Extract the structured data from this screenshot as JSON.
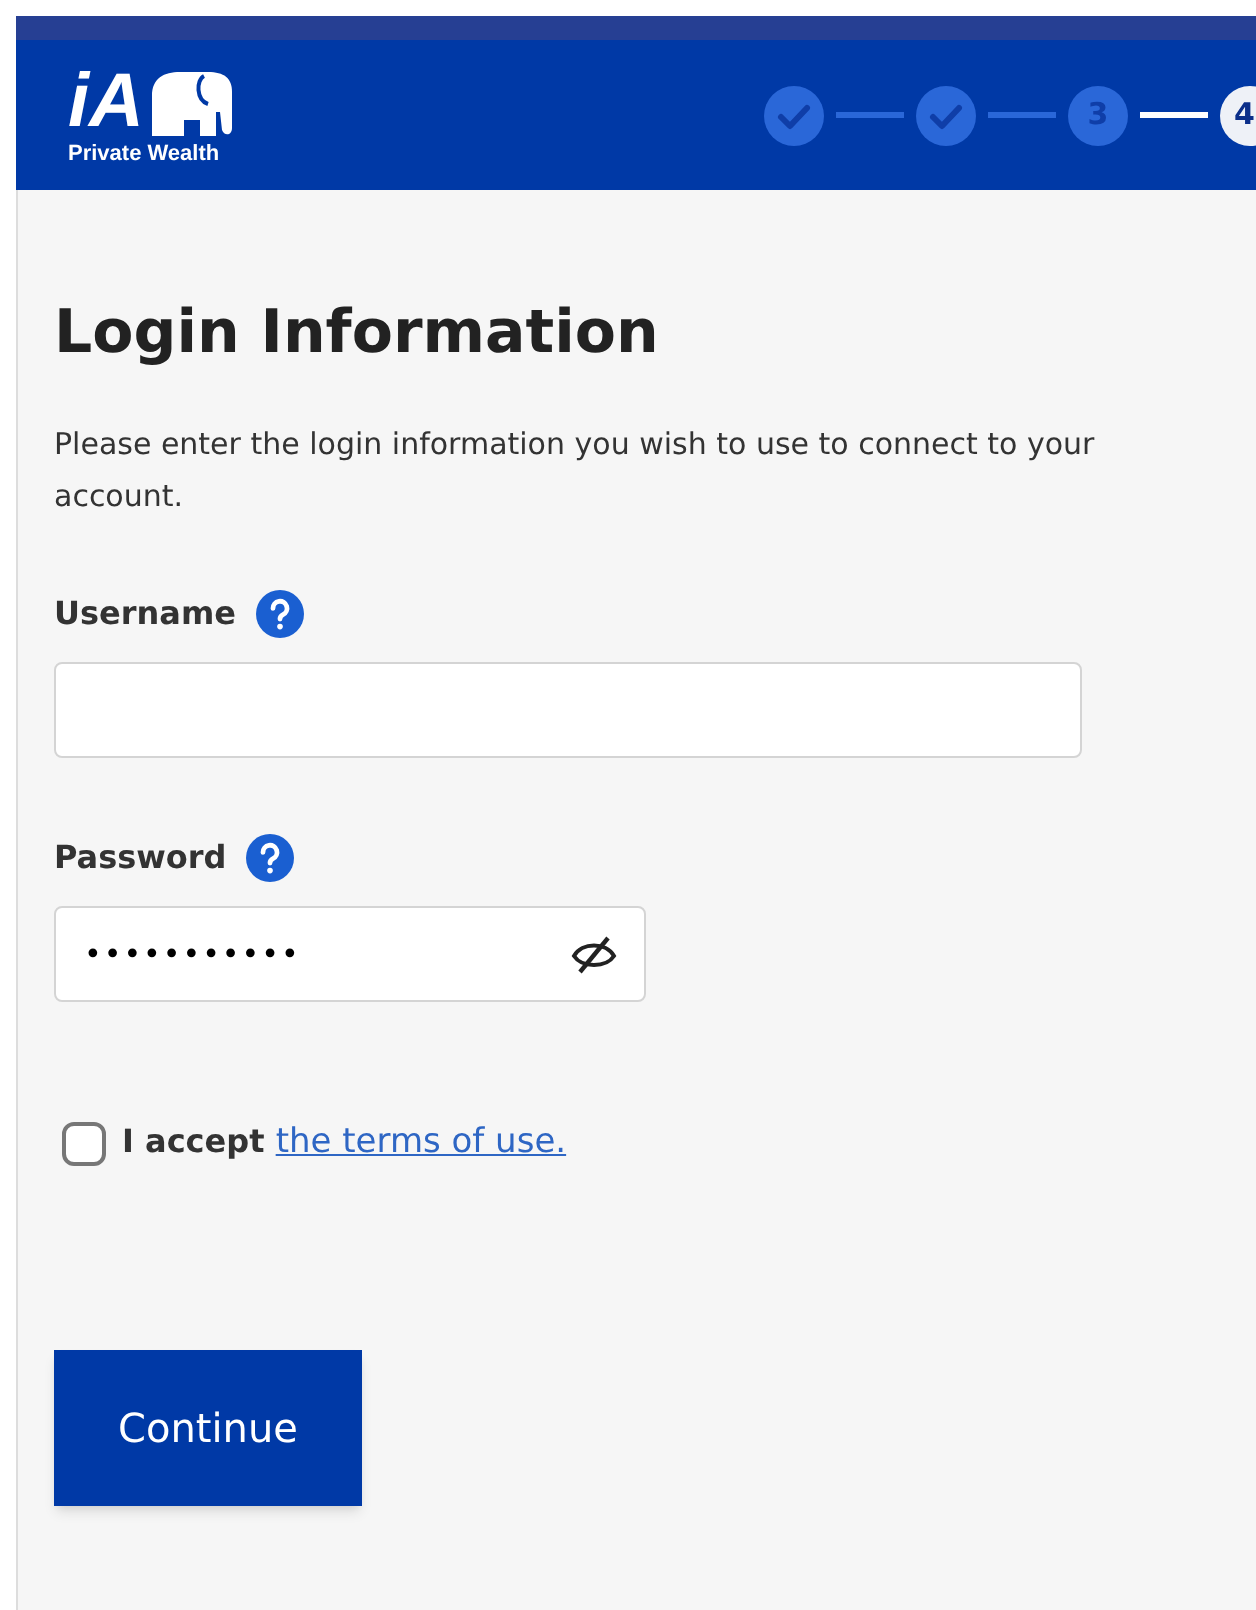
{
  "header": {
    "brand": "iA",
    "tagline": "Private Wealth",
    "steps": [
      {
        "completed": true,
        "selected": false
      },
      {
        "completed": true,
        "selected": false
      },
      {
        "completed": false,
        "selected": false,
        "label": "3"
      },
      {
        "completed": false,
        "selected": true,
        "label": "4"
      }
    ]
  },
  "title": "Login Information",
  "intro": "Please enter the login information you wish to use to connect to your account.",
  "fields": [
    {
      "label": "Username",
      "kind": "text"
    },
    {
      "label": "Password",
      "kind": "password",
      "value": "•••••••••••"
    }
  ],
  "terms": {
    "checked": false,
    "text": "I accept",
    "link": "the terms of use."
  },
  "button": "Continue"
}
